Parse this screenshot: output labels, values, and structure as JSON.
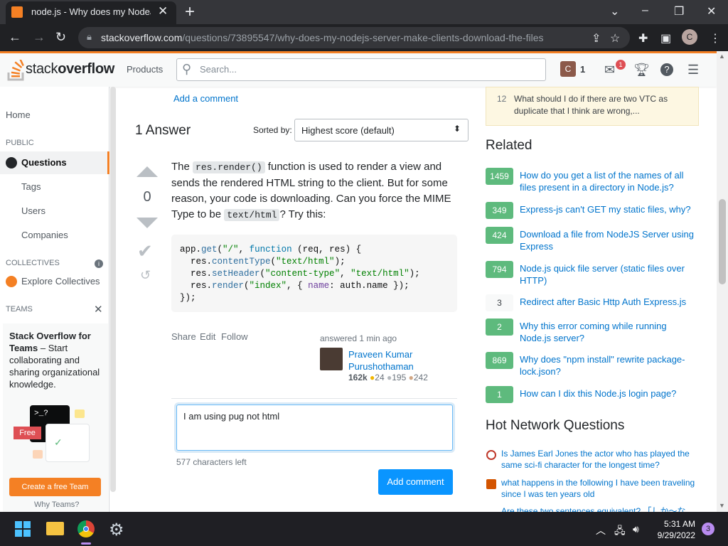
{
  "browser": {
    "tab_title": "node.js - Why does my NodeJS S",
    "url_host": "stackoverflow.com",
    "url_path": "/questions/73895547/why-does-my-nodejs-server-make-clients-download-the-files",
    "profile_initial": "C"
  },
  "header": {
    "logo_stack": "stack",
    "logo_overflow": "overflow",
    "products": "Products",
    "search_placeholder": "Search...",
    "avatar_initial": "C",
    "reputation": "1",
    "inbox_badge": "1"
  },
  "left_sidebar": {
    "home": "Home",
    "public_heading": "PUBLIC",
    "questions": "Questions",
    "tags": "Tags",
    "users": "Users",
    "companies": "Companies",
    "collectives_heading": "COLLECTIVES",
    "explore_collectives": "Explore Collectives",
    "teams_heading": "TEAMS",
    "teams_title": "Stack Overflow for Teams",
    "teams_desc": " – Start collaborating and sharing organizational knowledge.",
    "free_label": "Free",
    "create_team": "Create a free Team",
    "why_teams": "Why Teams?"
  },
  "main": {
    "add_comment_link": "Add a comment",
    "answers_count": "1 Answer",
    "sorted_by": "Sorted by:",
    "sort_value": "Highest score (default)",
    "vote_score": "0",
    "answer_text": {
      "p1": "The ",
      "c1": "res.render()",
      "p2": " function is used to render a view and sends the rendered HTML string to the client. But for some reason, your code is downloading. Can you force the MIME Type to be ",
      "c2": "text/html",
      "p3": "? Try this:"
    },
    "share": "Share",
    "edit": "Edit",
    "follow": "Follow",
    "answered": "answered 1 min ago",
    "author_name": "Praveen Kumar Purushothaman",
    "author_rep": "162k",
    "gold": "24",
    "silver": "195",
    "bronze": "242",
    "comment_value": "I am using pug not html",
    "chars_left": "577 characters left",
    "add_comment_btn": "Add comment"
  },
  "right_sidebar": {
    "meta_score": "12",
    "meta_title": "What should I do if there are two VTC as duplicate that I think are wrong,...",
    "related_heading": "Related",
    "related": [
      {
        "score": "1459",
        "title": "How do you get a list of the names of all files present in a directory in Node.js?"
      },
      {
        "score": "349",
        "title": "Express-js can't GET my static files, why?"
      },
      {
        "score": "424",
        "title": "Download a file from NodeJS Server using Express"
      },
      {
        "score": "794",
        "title": "Node.js quick file server (static files over HTTP)"
      },
      {
        "score": "3",
        "title": "Redirect after Basic Http Auth Express.js"
      },
      {
        "score": "2",
        "title": "Why this error coming while running Node.js server?"
      },
      {
        "score": "869",
        "title": "Why does \"npm install\" rewrite package-lock.json?"
      },
      {
        "score": "1",
        "title": "How can I dix this Node.js login page?"
      }
    ],
    "hnq_heading": "Hot Network Questions",
    "hnq": [
      {
        "title": "Is James Earl Jones the actor who has played the same sci-fi character for the longest time?"
      },
      {
        "title": "what happens in the following I have been traveling since I was ten years old"
      },
      {
        "title": "Are these two sentences equivalent? 「しか〜ない」"
      }
    ]
  },
  "taskbar": {
    "time": "5:31 AM",
    "date": "9/29/2022",
    "notif_count": "3"
  }
}
